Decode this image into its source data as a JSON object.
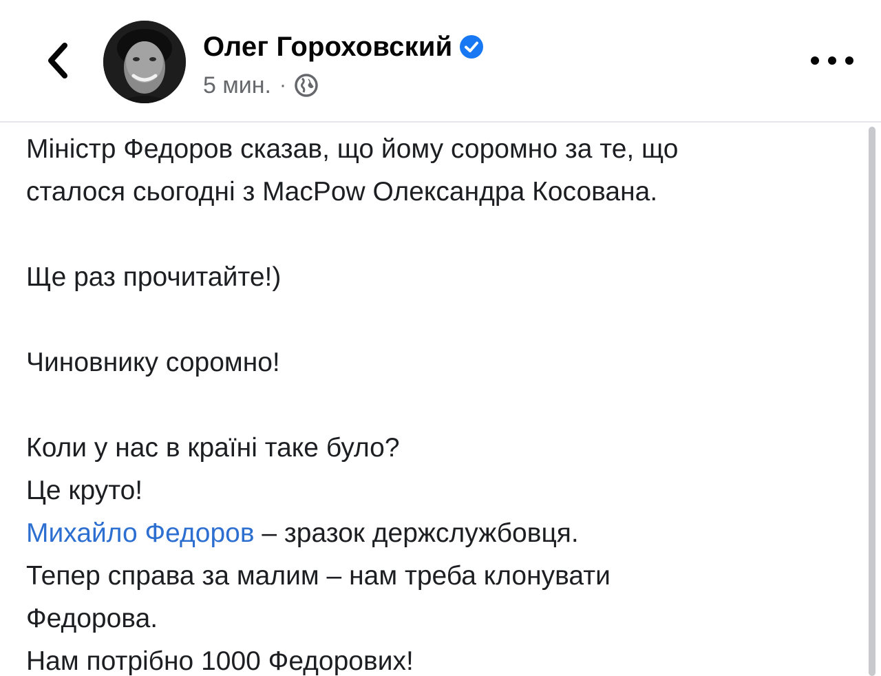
{
  "header": {
    "author_name": "Олег Гороховский",
    "time": "5 мин.",
    "separator": "·",
    "icons": {
      "back": "chevron-left-icon",
      "verified": "verified-badge-icon",
      "audience": "globe-icon",
      "more": "more-horizontal-icon"
    }
  },
  "post": {
    "para1": [
      "Міністр Федоров сказав, що йому соромно за те, що",
      "сталося сьогодні з MacPow Олександра Косована."
    ],
    "para2": "Ще раз прочитайте!)",
    "para3": "Чиновнику соромно!",
    "para4": [
      "Коли у нас в країні таке було?",
      "Це круто!"
    ],
    "mention": "Михайло Федоров",
    "mention_rest": " – зразок держслужбовця.",
    "para5": [
      "Тепер справа за малим – нам треба клонувати",
      "Федорова.",
      "Нам потрібно 1000 Федорових!"
    ]
  },
  "colors": {
    "link": "#2d6fd1",
    "verified": "#1877f2",
    "secondary_text": "#65676b"
  }
}
